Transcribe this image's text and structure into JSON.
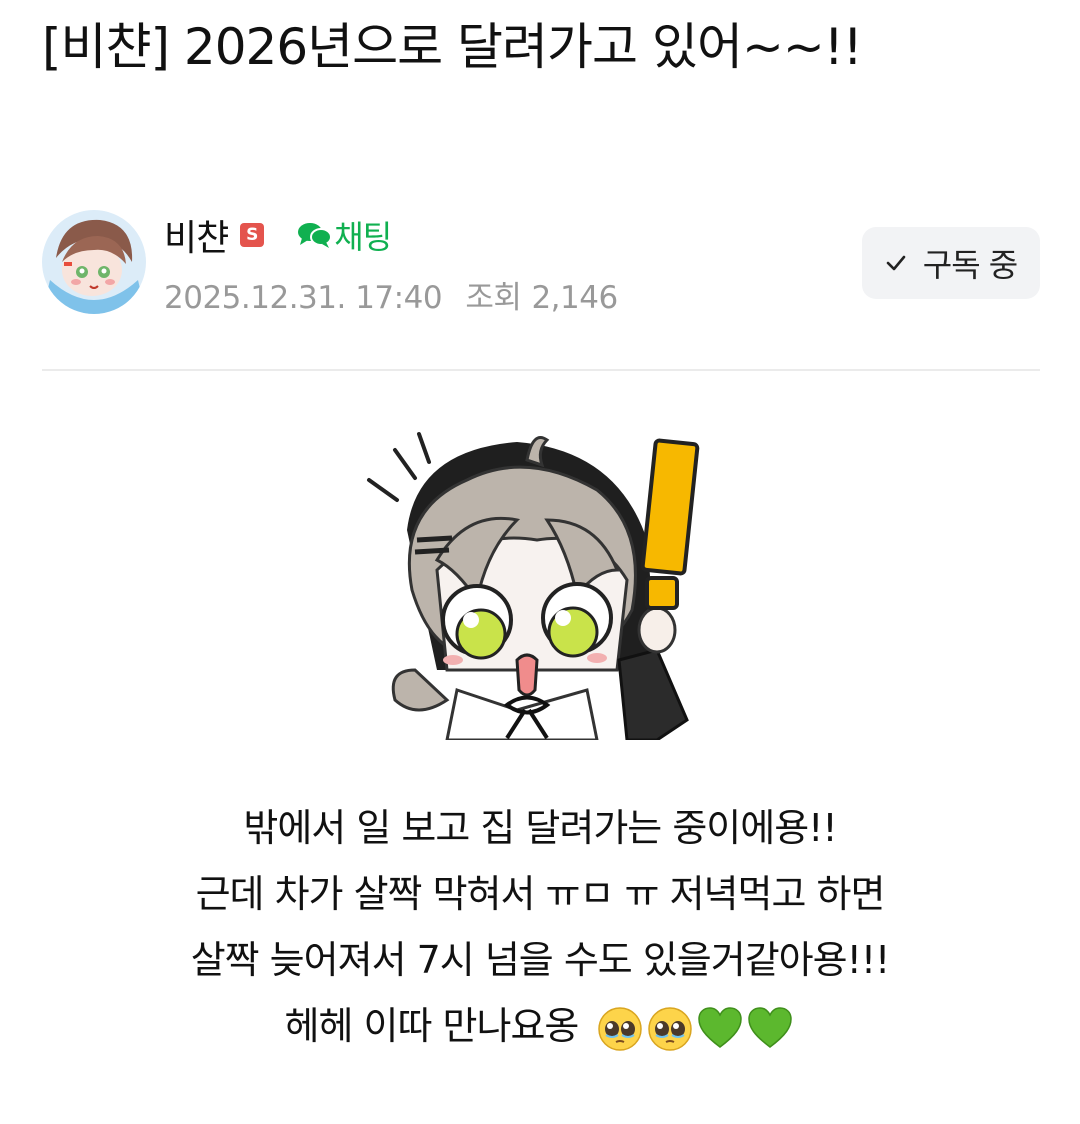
{
  "post": {
    "title": "[비챤] 2026년으로 달려가고 있어~~!!",
    "author": {
      "name": "비챤",
      "badge": "S",
      "chat_label": "채팅"
    },
    "meta": {
      "datetime": "2025.12.31. 17:40",
      "views_label": "조회",
      "views": "2,146"
    },
    "subscribe_label": "구독 중",
    "body_lines": [
      "밖에서 일 보고 집 달려가는 중이에용!!",
      "근데 차가 살짝 막혀서 ㅠㅁ ㅠ 저녁먹고 하면",
      "살짝 늦어져서 7시 넘을 수도 있을거같아용!!!",
      "헤헤 이따 만나요옹"
    ],
    "body_emojis": [
      "pleading-face",
      "pleading-face",
      "green-heart",
      "green-heart"
    ]
  },
  "colors": {
    "chat_green": "#10b050",
    "badge_red": "#e4544d",
    "meta_gray": "#999999",
    "button_bg": "#f2f3f5"
  }
}
